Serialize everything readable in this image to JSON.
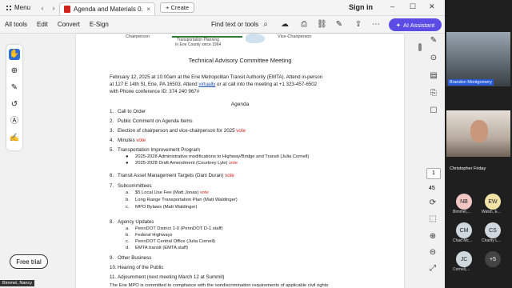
{
  "topbar": {
    "menu_label": "Menu",
    "tab_title": "Agenda and Materials 0...",
    "tab_close": "×",
    "create_label": "+ Create",
    "sign_in": "Sign in",
    "minimize": "–",
    "maximize": "☐",
    "close": "✕"
  },
  "toolbar": {
    "items": [
      "All tools",
      "Edit",
      "Convert",
      "E-Sign"
    ],
    "find": "Find text or tools",
    "ai_assistant": "AI Assistant"
  },
  "document": {
    "header": {
      "chairperson": "Chairperson",
      "vice_chairperson": "Vice-Chairperson",
      "tp_line1": "Transportation Planning",
      "tp_line2": "In Erie County since 1964"
    },
    "title": "Technical Advisory Committee Meeting",
    "para_line1": "February 12, 2025 at 10:00am at the Erie Metropolitan Transit Authority (EMTA).  Attend in-person",
    "para_line2_a": "at 127 E 14th St, Erie, PA 16503.   Attend ",
    "para_link": "virtually",
    "para_line2_b": " or at call into the meeting at +1 323-457-6502",
    "para_line3": "with Phone conference ID: 374 240 967#",
    "agenda_title": "Agenda",
    "items": [
      {
        "num": "1.",
        "text": "Call to Order",
        "vote": ""
      },
      {
        "num": "2.",
        "text": "Public Comment on Agenda Items",
        "vote": ""
      },
      {
        "num": "3.",
        "text": "Election of chairperson and vice-chairperson for 2025 ",
        "vote": "vote"
      },
      {
        "num": "4.",
        "text": "Minutes ",
        "vote": "vote"
      },
      {
        "num": "5.",
        "text": "Transportation Improvement Program",
        "vote": ""
      },
      {
        "num": "6.",
        "text": "Transit Asset Management Targets (Dani Duran) ",
        "vote": "vote"
      },
      {
        "num": "7.",
        "text": "Subcommittees",
        "vote": ""
      },
      {
        "num": "8.",
        "text": "Agency Updates",
        "vote": ""
      },
      {
        "num": "9.",
        "text": "Other Business",
        "vote": ""
      },
      {
        "num": "10.",
        "text": "Hearing of the Public",
        "vote": ""
      },
      {
        "num": "11.",
        "text": "Adjournment (next meeting March 12 at Summit)",
        "vote": ""
      }
    ],
    "sub5": [
      {
        "bullet": "●",
        "text": "2025-2028 Administrative modifications to Highway/Bridge and Transit (Julia Cornell)",
        "vote": ""
      },
      {
        "bullet": "●",
        "text": "2025-2028 Draft Amendment (Courtney Lyle) ",
        "vote": "vote"
      }
    ],
    "sub7": [
      {
        "bullet": "a.",
        "text": "$5 Local Use Fee (Matt Jonas) ",
        "vote": "vote"
      },
      {
        "bullet": "b.",
        "text": "Long Range Transportation Plan (Matt Waldinger)",
        "vote": ""
      },
      {
        "bullet": "c.",
        "text": "MPO Bylaws (Matt Waldinger)",
        "vote": ""
      }
    ],
    "sub8": [
      {
        "bullet": "a.",
        "text": "PennDOT District 1-0 (PennDOT D-1 staff)"
      },
      {
        "bullet": "b.",
        "text": "Federal Highways"
      },
      {
        "bullet": "c.",
        "text": "PennDOT Central Office (Julia Cornell)"
      },
      {
        "bullet": "d.",
        "text": "EMTA transit (EMTA staff)"
      }
    ],
    "footer_cut": "The Erie MPO is committed to compliance with the nondiscrimination requirements of applicable civil rights"
  },
  "viewer": {
    "page_number": "1",
    "page_count": "45",
    "free_trial": "Free trial"
  },
  "video": {
    "tile1_name": "Brandon Montgomery",
    "tile2_name": "Christopher Friday",
    "bottom_name": "Bimmel, Nancy",
    "participants": [
      {
        "initials": "NB",
        "name": "Bimmel,...",
        "color": "#f3c6c6"
      },
      {
        "initials": "EW",
        "name": "Walsh, E...",
        "color": "#f1e3a8"
      },
      {
        "initials": "CM",
        "name": "Chad Mc...",
        "color": "#cfd8dc"
      },
      {
        "initials": "CS",
        "name": "Charity L...",
        "color": "#cfd8dc"
      },
      {
        "initials": "JC",
        "name": "Cornell,...",
        "color": "#cfd8dc"
      },
      {
        "initials": "+5",
        "name": "",
        "color": "#444"
      }
    ]
  }
}
